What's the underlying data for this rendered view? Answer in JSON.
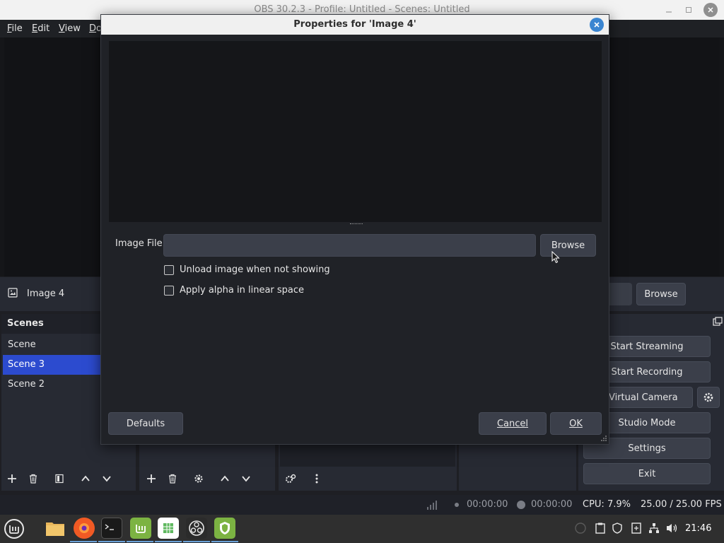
{
  "window": {
    "title": "OBS 30.2.3 - Profile: Untitled - Scenes: Untitled"
  },
  "menu": [
    {
      "pre": "",
      "u": "F",
      "post": "ile"
    },
    {
      "pre": "",
      "u": "E",
      "post": "dit"
    },
    {
      "pre": "",
      "u": "V",
      "post": "iew"
    },
    {
      "pre": "",
      "u": "D",
      "post": "o"
    }
  ],
  "source_bar": {
    "name": "Image 4",
    "browse_label": "Browse"
  },
  "scenes": {
    "header": "Scenes",
    "items": [
      "Scene",
      "Scene 3",
      "Scene 2"
    ],
    "active_index": 1
  },
  "controls": {
    "header": "ols",
    "start_streaming": "Start Streaming",
    "start_recording": "Start Recording",
    "virtual_camera": "rt Virtual Camera",
    "studio_mode": "Studio Mode",
    "settings": "Settings",
    "exit": "Exit"
  },
  "status": {
    "stream_time": "00:00:00",
    "record_time": "00:00:00",
    "cpu": "CPU: 7.9%",
    "fps": "25.00 / 25.00 FPS"
  },
  "dialog": {
    "title": "Properties for 'Image 4'",
    "image_file_label": "Image File",
    "image_file_value": "",
    "browse_label": "Browse",
    "unload_label": "Unload image when not showing",
    "unload_checked": false,
    "alpha_label": "Apply alpha in linear space",
    "alpha_checked": false,
    "defaults_label": "Defaults",
    "cancel_label": "Cancel",
    "ok_label": "OK"
  },
  "taskbar": {
    "clock": "21:46",
    "apps": [
      "menu-icon",
      "files-icon",
      "firefox-icon",
      "terminal-icon",
      "mintinstall-icon",
      "spreadsheet-icon",
      "obs-icon",
      "shield-icon"
    ]
  },
  "colors": {
    "accent": "#2c4bcf",
    "dialog_close": "#3a85d1",
    "panel": "#272a33",
    "preview": "#151619"
  }
}
